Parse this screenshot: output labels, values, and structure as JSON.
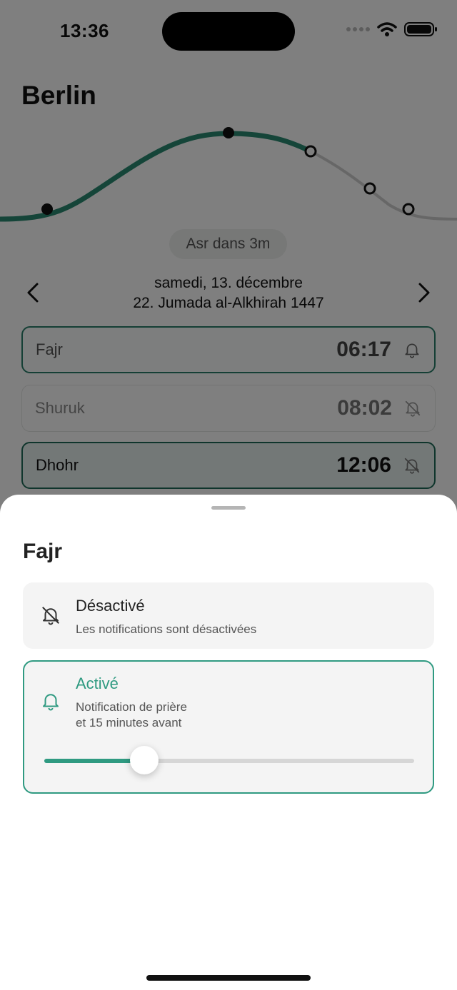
{
  "status_bar": {
    "time": "13:36"
  },
  "location": {
    "city": "Berlin"
  },
  "next_prayer": {
    "label": "Asr dans 3m"
  },
  "date": {
    "gregorian": "samedi, 13. décembre",
    "hijri": "22. Jumada al-Alkhirah 1447"
  },
  "prayers": [
    {
      "name": "Fajr",
      "time": "06:17",
      "notification": "on"
    },
    {
      "name": "Shuruk",
      "time": "08:02",
      "notification": "off"
    },
    {
      "name": "Dhohr",
      "time": "12:06",
      "notification": "off"
    }
  ],
  "sheet": {
    "title": "Fajr",
    "options": [
      {
        "label": "Désactivé",
        "description": "Les notifications sont désactivées",
        "icon": "bell-off-icon",
        "selected": false
      },
      {
        "label": "Activé",
        "description_line1": "Notification de prière",
        "description_line2": "et 15 minutes avant",
        "icon": "bell-icon",
        "selected": true
      }
    ],
    "slider": {
      "value_fraction": 0.27
    }
  },
  "colors": {
    "accent": "#2f9a81",
    "dark_accent": "#1f6b58"
  }
}
